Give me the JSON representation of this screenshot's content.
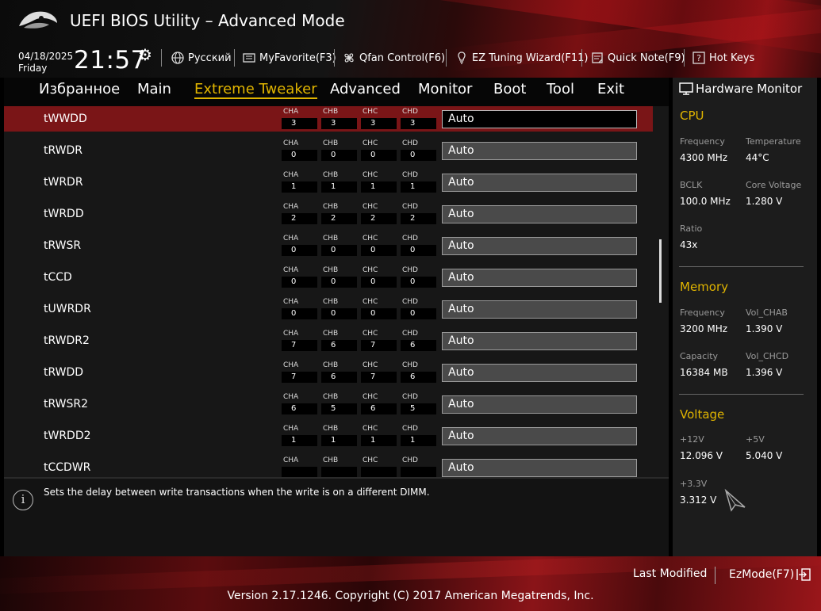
{
  "header": {
    "title": "UEFI BIOS Utility – Advanced Mode",
    "date": "04/18/2025",
    "day": "Friday",
    "time": "21:57",
    "items": [
      {
        "label": "Русский",
        "icon": "globe-icon"
      },
      {
        "label": "MyFavorite(F3)",
        "icon": "favorite-icon"
      },
      {
        "label": "Qfan Control(F6)",
        "icon": "fan-icon"
      },
      {
        "label": "EZ Tuning Wizard(F11)",
        "icon": "bulb-icon"
      },
      {
        "label": "Quick Note(F9)",
        "icon": "note-icon"
      },
      {
        "label": "Hot Keys",
        "icon": "help-key-icon"
      }
    ]
  },
  "nav": {
    "tabs": [
      "Избранное",
      "Main",
      "Extreme Tweaker",
      "Advanced",
      "Monitor",
      "Boot",
      "Tool",
      "Exit"
    ],
    "active": "Extreme Tweaker"
  },
  "rows": [
    {
      "label": "tWWDD",
      "values": [
        "3",
        "3",
        "3",
        "3"
      ],
      "setting": "Auto"
    },
    {
      "label": "tRWDR",
      "values": [
        "0",
        "0",
        "0",
        "0"
      ],
      "setting": "Auto"
    },
    {
      "label": "tWRDR",
      "values": [
        "1",
        "1",
        "1",
        "1"
      ],
      "setting": "Auto"
    },
    {
      "label": "tWRDD",
      "values": [
        "2",
        "2",
        "2",
        "2"
      ],
      "setting": "Auto"
    },
    {
      "label": "tRWSR",
      "values": [
        "0",
        "0",
        "0",
        "0"
      ],
      "setting": "Auto"
    },
    {
      "label": "tCCD",
      "values": [
        "0",
        "0",
        "0",
        "0"
      ],
      "setting": "Auto"
    },
    {
      "label": "tUWRDR",
      "values": [
        "0",
        "0",
        "0",
        "0"
      ],
      "setting": "Auto"
    },
    {
      "label": "tRWDR2",
      "values": [
        "7",
        "6",
        "7",
        "6"
      ],
      "setting": "Auto"
    },
    {
      "label": "tRWDD",
      "values": [
        "7",
        "6",
        "7",
        "6"
      ],
      "setting": "Auto"
    },
    {
      "label": "tRWSR2",
      "values": [
        "6",
        "5",
        "6",
        "5"
      ],
      "setting": "Auto"
    },
    {
      "label": "tWRDD2",
      "values": [
        "1",
        "1",
        "1",
        "1"
      ],
      "setting": "Auto"
    },
    {
      "label": "tCCDWR",
      "values": [
        "",
        "",
        "",
        ""
      ],
      "setting": "Auto"
    }
  ],
  "channels": [
    "CHA",
    "CHB",
    "CHC",
    "CHD"
  ],
  "help_text": "Sets the delay between write transactions when the write is on a different DIMM.",
  "hw_monitor": {
    "title": "Hardware Monitor",
    "cpu": {
      "section": "CPU",
      "frequency_label": "Frequency",
      "frequency": "4300 MHz",
      "temperature_label": "Temperature",
      "temperature": "44°C",
      "bclk_label": "BCLK",
      "bclk": "100.0 MHz",
      "core_voltage_label": "Core Voltage",
      "core_voltage": "1.280 V",
      "ratio_label": "Ratio",
      "ratio": "43x"
    },
    "memory": {
      "section": "Memory",
      "frequency_label": "Frequency",
      "frequency": "3200 MHz",
      "vol_chab_label": "Vol_CHAB",
      "vol_chab": "1.390 V",
      "capacity_label": "Capacity",
      "capacity": "16384 MB",
      "vol_chcd_label": "Vol_CHCD",
      "vol_chcd": "1.396 V"
    },
    "voltage": {
      "section": "Voltage",
      "v12_label": "+12V",
      "v12": "12.096 V",
      "v5_label": "+5V",
      "v5": "5.040 V",
      "v33_label": "+3.3V",
      "v33": "3.312 V"
    }
  },
  "footer": {
    "last_modified": "Last Modified",
    "ezmode": "EzMode(F7)",
    "version": "Version 2.17.1246. Copyright (C) 2017 American Megatrends, Inc."
  },
  "colors": {
    "accent": "#e0b400",
    "selected_row": "#7a1517"
  }
}
